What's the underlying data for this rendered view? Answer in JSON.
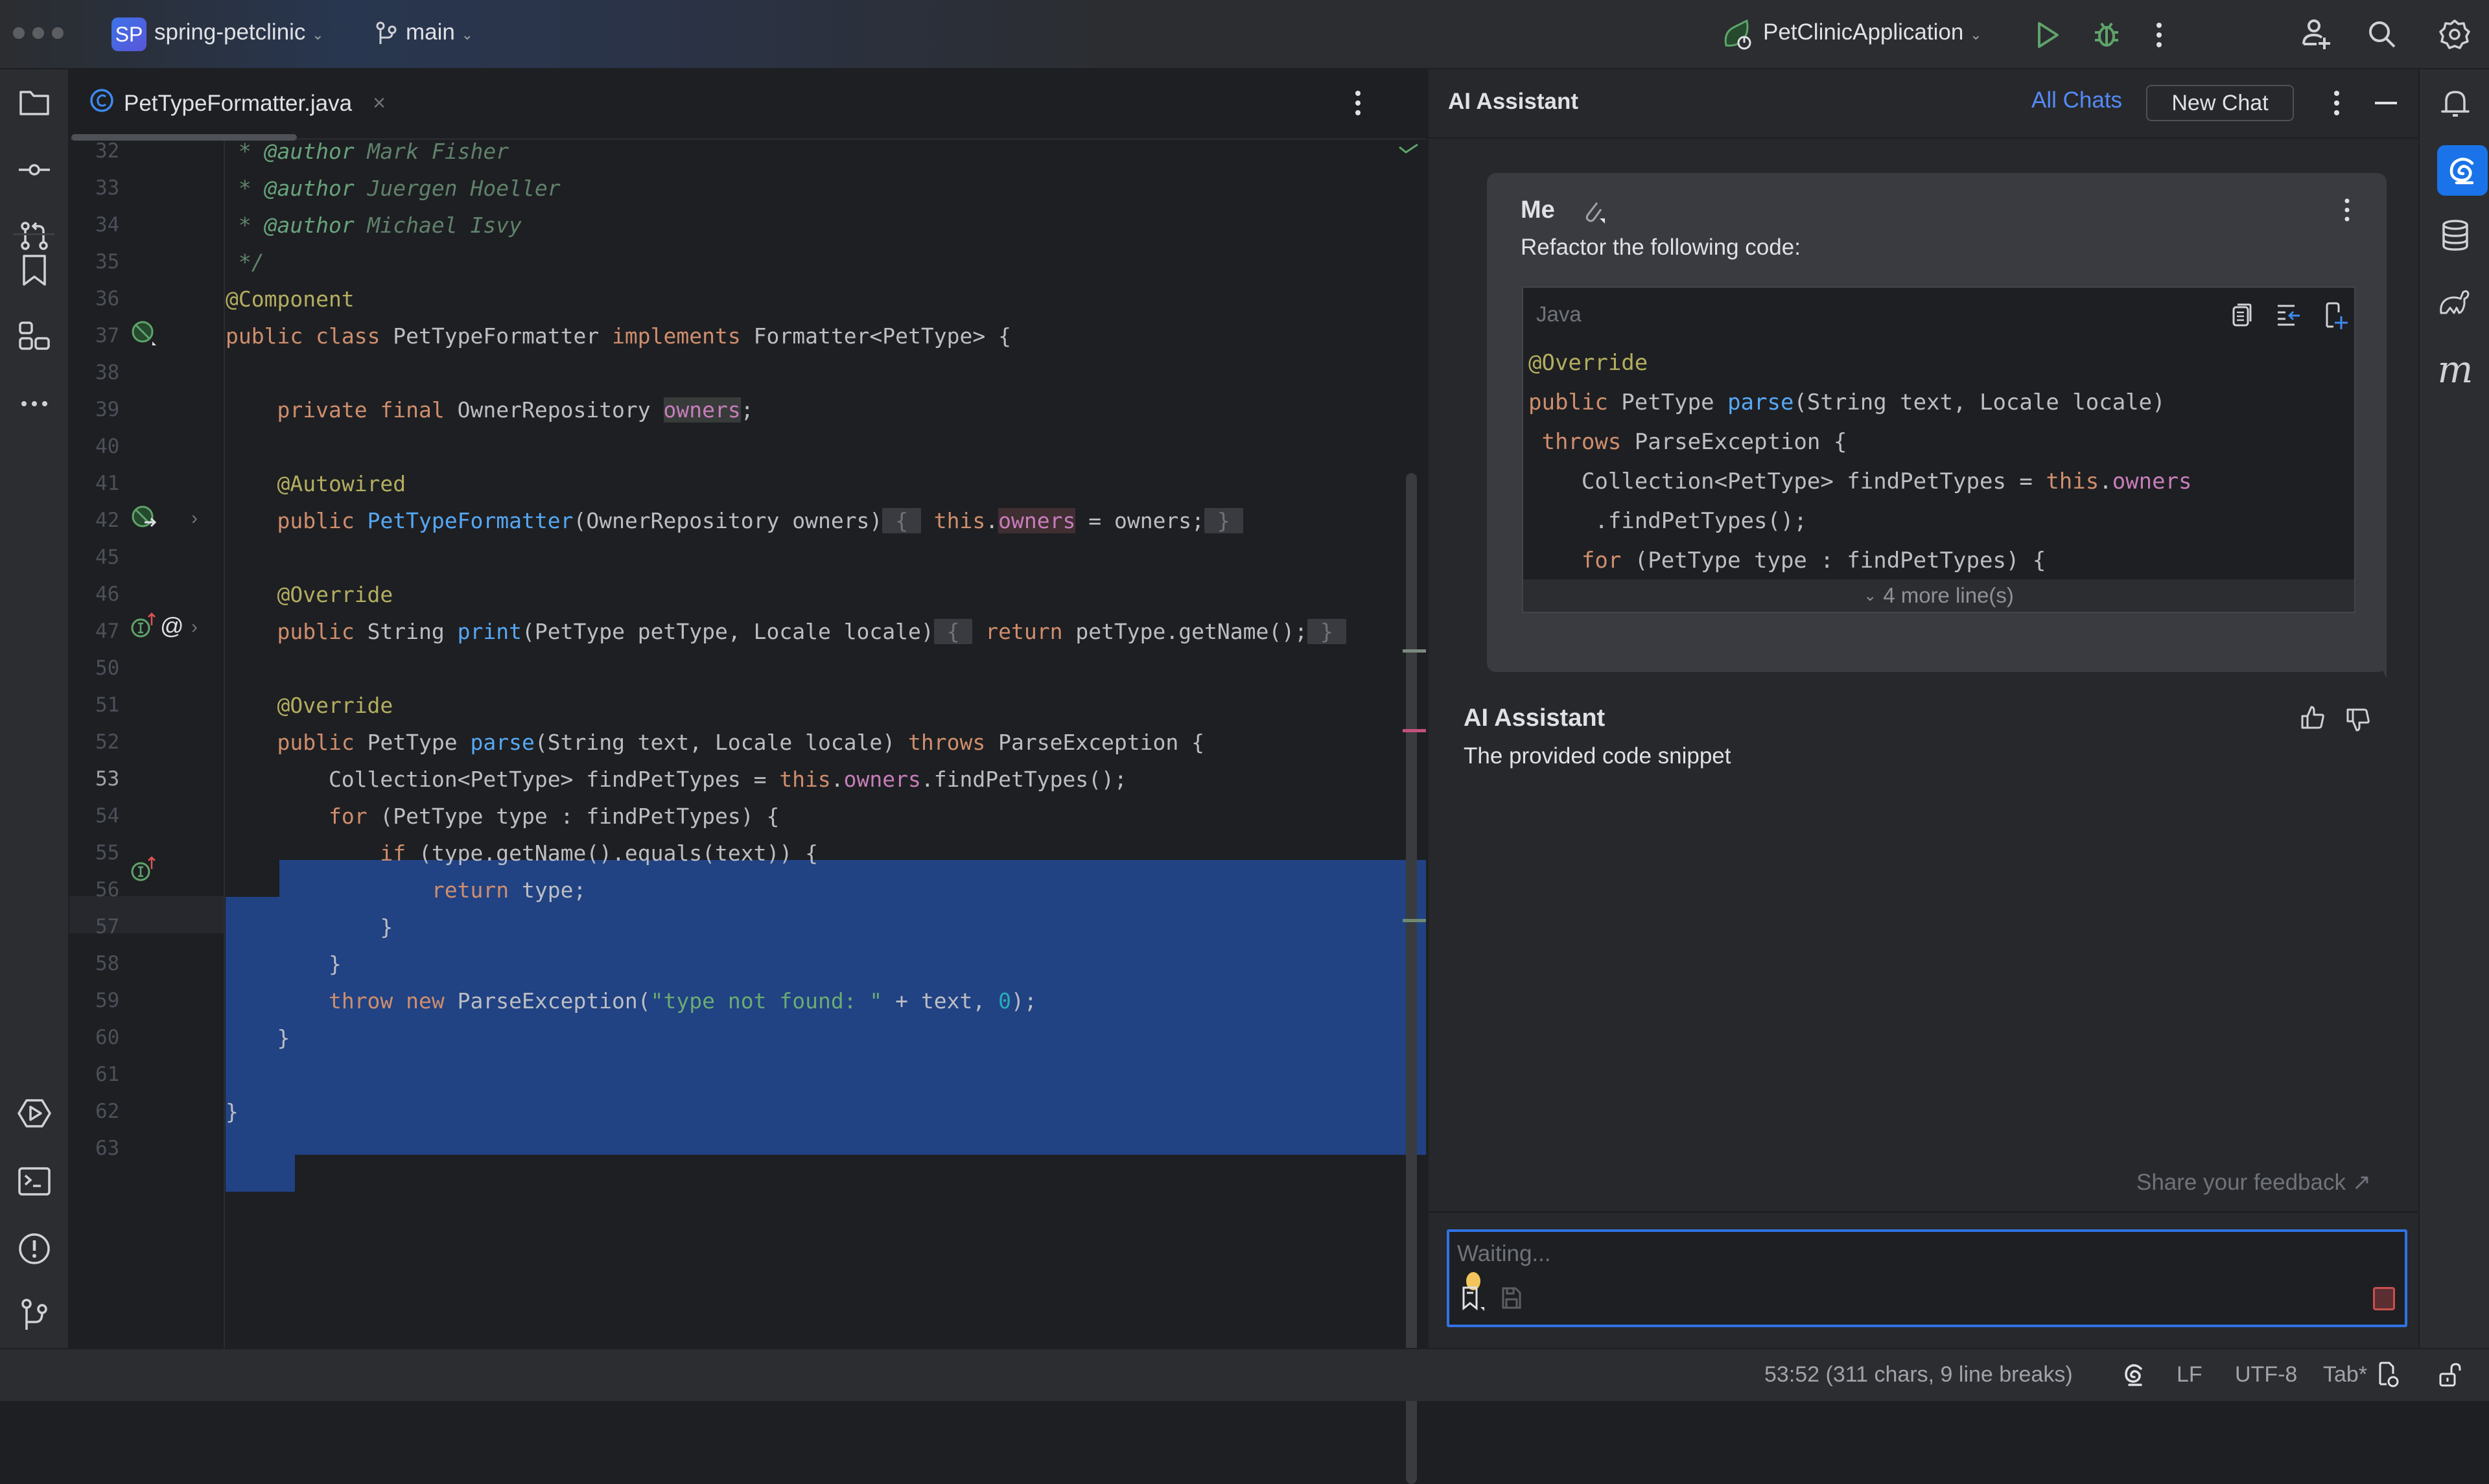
{
  "titlebar": {
    "project_badge": "SP",
    "project_name": "spring-petclinic",
    "branch": "main",
    "run_config": "PetClinicApplication",
    "icons": [
      "window-dots-icon",
      "branch-icon",
      "spring-app-icon",
      "run-icon",
      "debug-icon",
      "more-icon",
      "add-user-icon",
      "search-icon",
      "settings-icon"
    ]
  },
  "left_strip": {
    "top_icons": [
      "project-folder-icon",
      "commit-icon",
      "pull-requests-icon",
      "bookmarks-icon",
      "structure-icon",
      "more-tools-icon"
    ],
    "bottom_icons": [
      "services-icon",
      "terminal-icon",
      "problems-icon",
      "git-icon"
    ]
  },
  "editor": {
    "tab_label": "PetTypeFormatter.java",
    "tab_icon": "java-class-icon",
    "current_line": "53",
    "lines": [
      {
        "n": "32",
        "t": "cmt",
        "text": " * @author Mark Fisher"
      },
      {
        "n": "33",
        "t": "cmt",
        "text": " * @author Juergen Hoeller"
      },
      {
        "n": "34",
        "t": "cmt",
        "text": " * @author Michael Isvy"
      },
      {
        "n": "35",
        "t": "cmt",
        "text": " */"
      },
      {
        "n": "36",
        "text": "@Component"
      },
      {
        "n": "37",
        "text": "public class PetTypeFormatter implements Formatter<PetType> {"
      },
      {
        "n": "38",
        "text": ""
      },
      {
        "n": "39",
        "text": "    private final OwnerRepository owners;"
      },
      {
        "n": "40",
        "text": ""
      },
      {
        "n": "41",
        "text": "    @Autowired"
      },
      {
        "n": "42",
        "text": "    public PetTypeFormatter(OwnerRepository owners) { this.owners = owners; }"
      },
      {
        "n": "45",
        "text": ""
      },
      {
        "n": "46",
        "text": "    @Override"
      },
      {
        "n": "47",
        "text": "    public String print(PetType petType, Locale locale) { return petType.getName(); }"
      },
      {
        "n": "50",
        "text": ""
      },
      {
        "n": "51",
        "text": "    @Override"
      },
      {
        "n": "52",
        "text": "    public PetType parse(String text, Locale locale) throws ParseException {"
      },
      {
        "n": "53",
        "text": "        Collection<PetType> findPetTypes = this.owners.findPetTypes();"
      },
      {
        "n": "54",
        "text": "        for (PetType type : findPetTypes) {"
      },
      {
        "n": "55",
        "text": "            if (type.getName().equals(text)) {"
      },
      {
        "n": "56",
        "text": "                return type;"
      },
      {
        "n": "57",
        "text": "            }"
      },
      {
        "n": "58",
        "text": "        }"
      },
      {
        "n": "59",
        "text": "        throw new ParseException(\"type not found: \" + text, 0);"
      },
      {
        "n": "60",
        "text": "    }"
      },
      {
        "n": "61",
        "text": ""
      },
      {
        "n": "62",
        "text": "}"
      },
      {
        "n": "63",
        "text": ""
      }
    ]
  },
  "ai_panel": {
    "title": "AI Assistant",
    "all_chats": "All Chats",
    "new_chat": "New Chat",
    "me_label": "Me",
    "me_message": "Refactor the following code:",
    "code_lang": "Java",
    "code_lines": [
      "@Override",
      "public PetType parse(String text, Locale locale)",
      " throws ParseException {",
      "    Collection<PetType> findPetTypes = this.owners",
      "     .findPetTypes();",
      "    for (PetType type : findPetTypes) {"
    ],
    "more_lines": "4 more line(s)",
    "assistant_label": "AI Assistant",
    "assistant_message": "The provided code snippet",
    "feedback_link": "Share your feedback ↗",
    "input_placeholder": "Waiting...",
    "accent": "#2f72e3"
  },
  "right_strip": {
    "icons": [
      "notifications-icon",
      "ai-assistant-icon",
      "database-icon",
      "gradle-icon",
      "maven-icon"
    ]
  },
  "statusbar": {
    "position": "53:52 (311 chars, 9 line breaks)",
    "line_sep": "LF",
    "encoding": "UTF-8",
    "indent": "Tab*"
  }
}
